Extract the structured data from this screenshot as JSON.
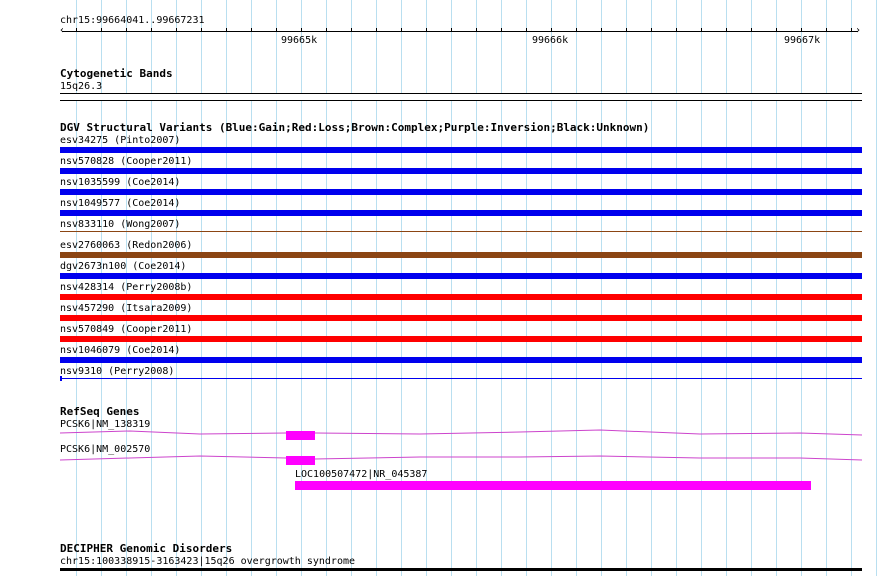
{
  "ruler": {
    "range_label": "chr15:99664041..99667231",
    "tick_labels": [
      "99665k",
      "99666k",
      "99667k"
    ]
  },
  "cytogenetic": {
    "title": "Cytogenetic Bands",
    "band": "15q26.3"
  },
  "dgv": {
    "title": "DGV Structural Variants (Blue:Gain;Red:Loss;Brown:Complex;Purple:Inversion;Black:Unknown)",
    "colors": {
      "gain": "#0000ee",
      "loss": "#ff0000",
      "complex": "#8b4513",
      "unknown": "#000000"
    },
    "variants": [
      {
        "label": "esv34275 (Pinto2007)",
        "type": "gain"
      },
      {
        "label": "nsv570828 (Cooper2011)",
        "type": "gain"
      },
      {
        "label": "nsv1035599 (Coe2014)",
        "type": "gain"
      },
      {
        "label": "nsv1049577 (Coe2014)",
        "type": "gain"
      },
      {
        "label": "nsv833110 (Wong2007)",
        "type": "complex"
      },
      {
        "label": "esv2760063 (Redon2006)",
        "type": "complex"
      },
      {
        "label": "dgv2673n100 (Coe2014)",
        "type": "gain"
      },
      {
        "label": "nsv428314 (Perry2008b)",
        "type": "loss"
      },
      {
        "label": "nsv457290 (Itsara2009)",
        "type": "loss"
      },
      {
        "label": "nsv570849 (Cooper2011)",
        "type": "loss"
      },
      {
        "label": "nsv1046079 (Coe2014)",
        "type": "gain"
      },
      {
        "label": "nsv9310 (Perry2008)",
        "type": "gain"
      }
    ]
  },
  "refseq": {
    "title": "RefSeq Genes",
    "color": "#ff00ff",
    "intron_color": "#cc44cc",
    "genes": [
      {
        "label": "PCSK6|NM_138319"
      },
      {
        "label": "PCSK6|NM_002570"
      },
      {
        "label": "LOC100507472|NR_045387"
      }
    ]
  },
  "decipher": {
    "title": "DECIPHER Genomic Disorders",
    "entry": "chr15:100338915-3163423|15q26 overgrowth syndrome"
  }
}
